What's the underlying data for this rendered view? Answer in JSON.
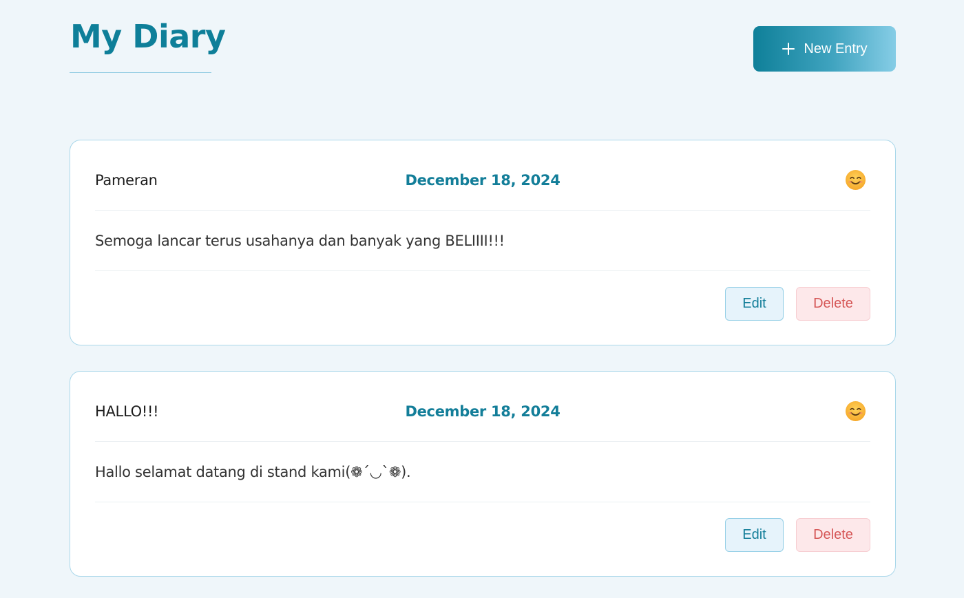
{
  "header": {
    "title": "My Diary",
    "new_entry_label": "New Entry"
  },
  "entries": [
    {
      "title": "Pameran",
      "date": "December 18, 2024",
      "mood_icon": "smiling-face-icon",
      "content": "Semoga lancar terus usahanya dan banyak yang BELIIII!!!",
      "edit_label": "Edit",
      "delete_label": "Delete"
    },
    {
      "title": "HALLO!!!",
      "date": "December 18, 2024",
      "mood_icon": "smiling-face-icon",
      "content": "Hallo selamat datang di stand kami(❁´◡`❁).",
      "edit_label": "Edit",
      "delete_label": "Delete"
    }
  ],
  "colors": {
    "accent": "#0e7f99",
    "background": "#eff6fa",
    "card_border": "#a9d7ea",
    "delete": "#d55656"
  }
}
